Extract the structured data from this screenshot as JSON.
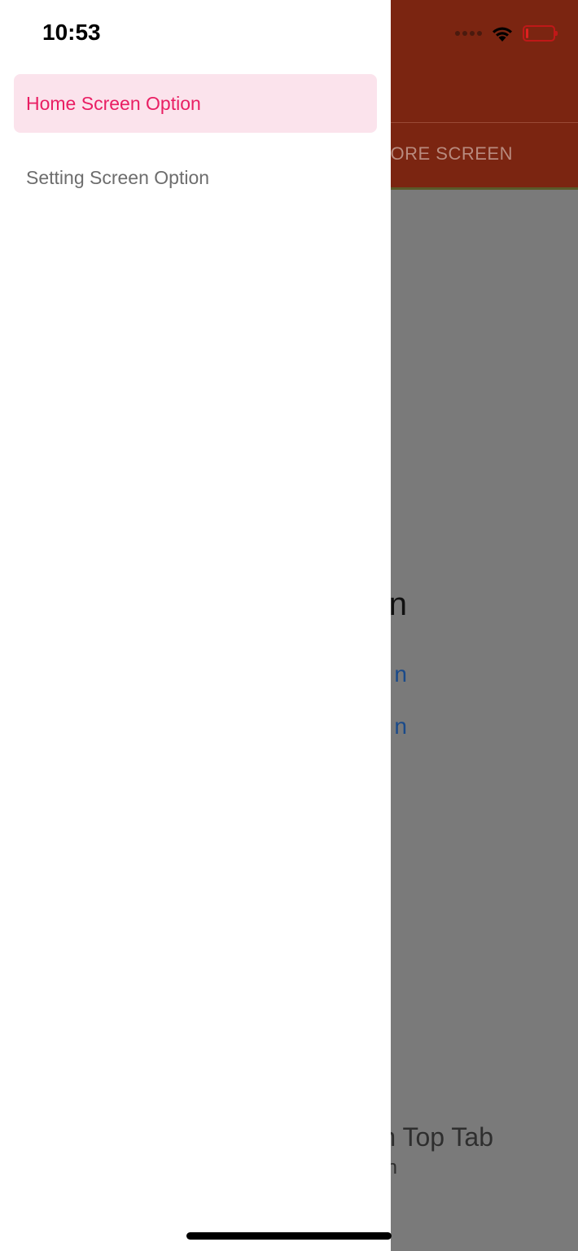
{
  "status_bar": {
    "time": "10:53",
    "battery_level_fraction": 0.1,
    "icons": [
      "signal-dots-icon",
      "wifi-icon",
      "battery-low-icon"
    ]
  },
  "drawer": {
    "items": [
      {
        "label": "Home Screen Option",
        "active": true
      },
      {
        "label": "Setting Screen Option",
        "active": false
      }
    ],
    "colors": {
      "active_text": "#e91e63",
      "active_background": "#fbe3ec",
      "inactive_text": "#6d6d6d"
    }
  },
  "background_screen": {
    "header_color": "#7b2511",
    "tab_label": "LORE SCREEN",
    "title_fragment": "n",
    "link_fragments": [
      "n",
      "n"
    ],
    "footer_title": "n Top Tab",
    "footer_subtitle": "n"
  }
}
